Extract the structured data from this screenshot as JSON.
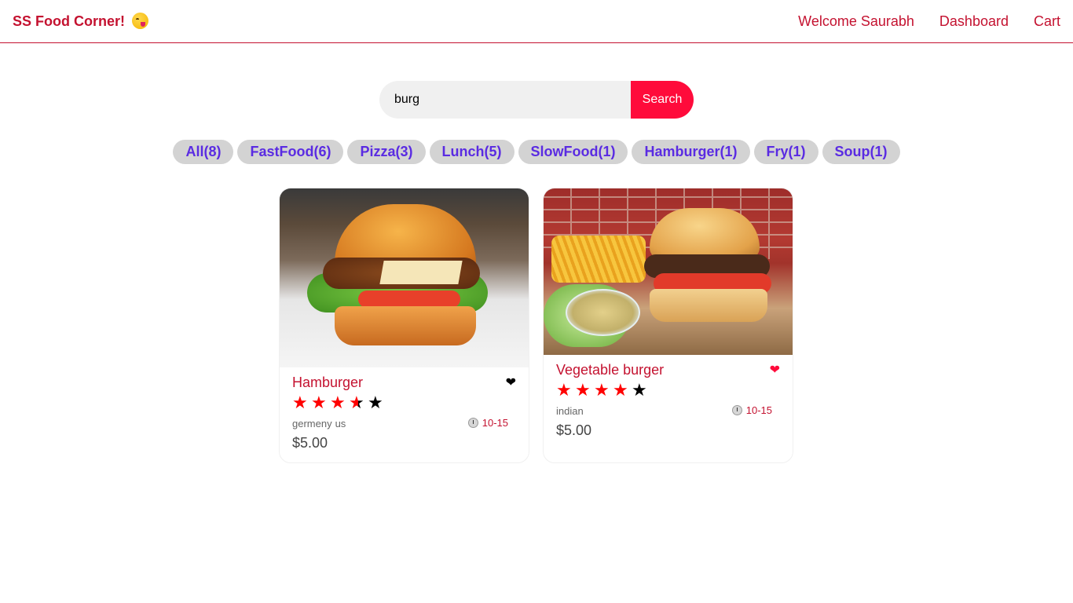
{
  "header": {
    "logo": "SS Food Corner!",
    "logo_emoji_icon": "face-savoring-food-icon",
    "nav": {
      "welcome": "Welcome Saurabh",
      "dashboard": "Dashboard",
      "cart": "Cart"
    }
  },
  "search": {
    "value": "burg",
    "button_label": "Search"
  },
  "tags": [
    "All(8)",
    "FastFood(6)",
    "Pizza(3)",
    "Lunch(5)",
    "SlowFood(1)",
    "Hamburger(1)",
    "Fry(1)",
    "Soup(1)"
  ],
  "foods": [
    {
      "name": "Hamburger",
      "favorite": false,
      "heart": "❤",
      "rating": 3.5,
      "stars": [
        "★",
        "★",
        "★",
        "★",
        "★"
      ],
      "origins": [
        "germeny",
        "us"
      ],
      "cook_time": "10-15",
      "price": "$5.00"
    },
    {
      "name": "Vegetable burger",
      "favorite": true,
      "heart": "❤",
      "rating": 4,
      "stars": [
        "★",
        "★",
        "★",
        "★",
        "★"
      ],
      "origins": [
        "indian"
      ],
      "cook_time": "10-15",
      "price": "$5.00"
    }
  ],
  "colors": {
    "brand": "#c41230",
    "search_button": "#ff0b3b",
    "tag_text": "#5a2be2",
    "tag_bg": "#d3d3d3",
    "star_full": "#ff0000"
  }
}
